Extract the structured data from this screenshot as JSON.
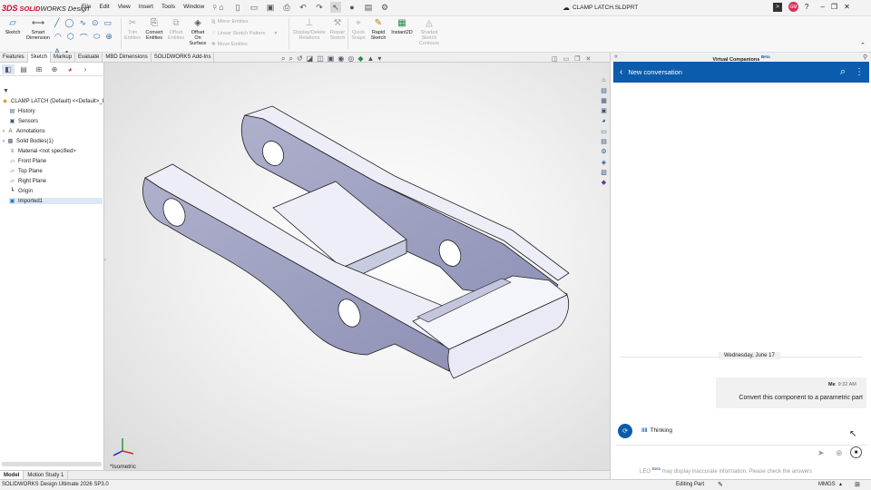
{
  "app": {
    "brand": "SOLIDWORKS Design",
    "brand_mark": "3DS",
    "brand_prefix": "SOLID",
    "brand_suffix": "WORKS Design",
    "doc_title": "CLAMP LATCH.SLDPRT",
    "avatar_initials": "GM"
  },
  "menu": [
    "File",
    "Edit",
    "View",
    "Insert",
    "Tools",
    "Window"
  ],
  "ribbon": {
    "sketch": "Sketch",
    "smart_dimension": [
      "Smart",
      "Dimension"
    ],
    "trim_entities": [
      "Trim",
      "Entities"
    ],
    "convert_entities": [
      "Convert",
      "Entities"
    ],
    "offset_entities": [
      "Offset",
      "Entities"
    ],
    "offset_on_surface": [
      "Offset",
      "On",
      "Surface"
    ],
    "mirror_entities": "Mirror Entities",
    "linear_sketch_pattern": "Linear Sketch Pattern",
    "move_entities": "Move Entities",
    "display_delete_relations": [
      "Display/Delete",
      "Relations"
    ],
    "repair_sketch": [
      "Repair",
      "Sketch"
    ],
    "quick_snaps": [
      "Quick",
      "Snaps"
    ],
    "rapid_sketch": [
      "Rapid",
      "Sketch"
    ],
    "instant2d": "Instant2D",
    "shaded_sketch_contours": [
      "Shaded",
      "Sketch",
      "Contours"
    ]
  },
  "tabs": [
    "Features",
    "Sketch",
    "Markup",
    "Evaluate",
    "MBD Dimensions",
    "SOLIDWORKS Add-Ins"
  ],
  "active_tab": "Sketch",
  "tree": {
    "root": "CLAMP LATCH (Default) <<Default>_I",
    "items": [
      "History",
      "Sensors",
      "Annotations",
      "Solid Bodies(1)",
      "Material <not specified>",
      "Front Plane",
      "Top Plane",
      "Right Plane",
      "Origin",
      "Imported1"
    ]
  },
  "viewport": {
    "view_label": "*Isometric"
  },
  "bottom_tabs": [
    "Model",
    "Motion Study 1"
  ],
  "status": {
    "version": "SOLIDWORKS Design Ultimate 2026 SP3.0",
    "mode": "Editing Part",
    "units": "MMGS"
  },
  "assistant": {
    "panel_title": "Virtual Companions",
    "panel_badge": "Beta",
    "conversation_title": "New conversation",
    "date": "Wednesday, June 17",
    "user_name": "Me",
    "time": "9:32 AM",
    "message": "Convert this component to a parametric part",
    "thinking": "Thinking",
    "disclaimer_prefix": "LEO",
    "disclaimer_badge": "Beta",
    "disclaimer": "may display inaccurate information. Please check the answers"
  },
  "colors": {
    "accent": "#0b5cad",
    "model_face": "#9fa2c2",
    "model_top": "#ececf8",
    "brand_red": "#c8102e"
  }
}
